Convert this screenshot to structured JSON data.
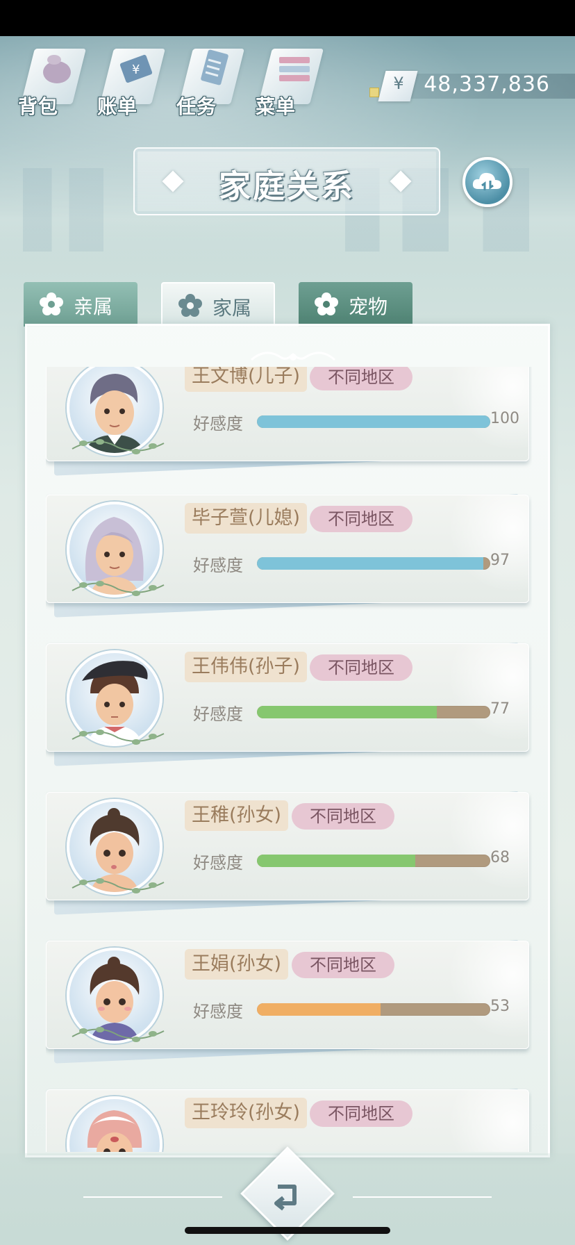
{
  "top_menu": [
    {
      "label": "背包",
      "icon": "bag-icon"
    },
    {
      "label": "账单",
      "icon": "bill-icon"
    },
    {
      "label": "任务",
      "icon": "task-icon"
    },
    {
      "label": "菜单",
      "icon": "menu-icon"
    }
  ],
  "money": {
    "currency_symbol": "¥",
    "amount": "48,337,836"
  },
  "title": "家庭关系",
  "tabs": [
    {
      "label": "亲属",
      "active": false
    },
    {
      "label": "家属",
      "active": true
    },
    {
      "label": "宠物",
      "active": false
    }
  ],
  "affinity_label": "好感度",
  "members": [
    {
      "name": "王文博(儿子)",
      "region": "不同地区",
      "affinity": 100,
      "bar_color": "#7ec3d9"
    },
    {
      "name": "毕子萱(儿媳)",
      "region": "不同地区",
      "affinity": 97,
      "bar_color": "#7ec3d9"
    },
    {
      "name": "王伟伟(孙子)",
      "region": "不同地区",
      "affinity": 77,
      "bar_color": "#86c76f"
    },
    {
      "name": "王稚(孙女)",
      "region": "不同地区",
      "affinity": 68,
      "bar_color": "#86c76f"
    },
    {
      "name": "王娟(孙女)",
      "region": "不同地区",
      "affinity": 53,
      "bar_color": "#f0ae63"
    },
    {
      "name": "王玲玲(孙女)",
      "region": "不同地区",
      "affinity": null,
      "bar_color": "#f0ae63"
    }
  ]
}
